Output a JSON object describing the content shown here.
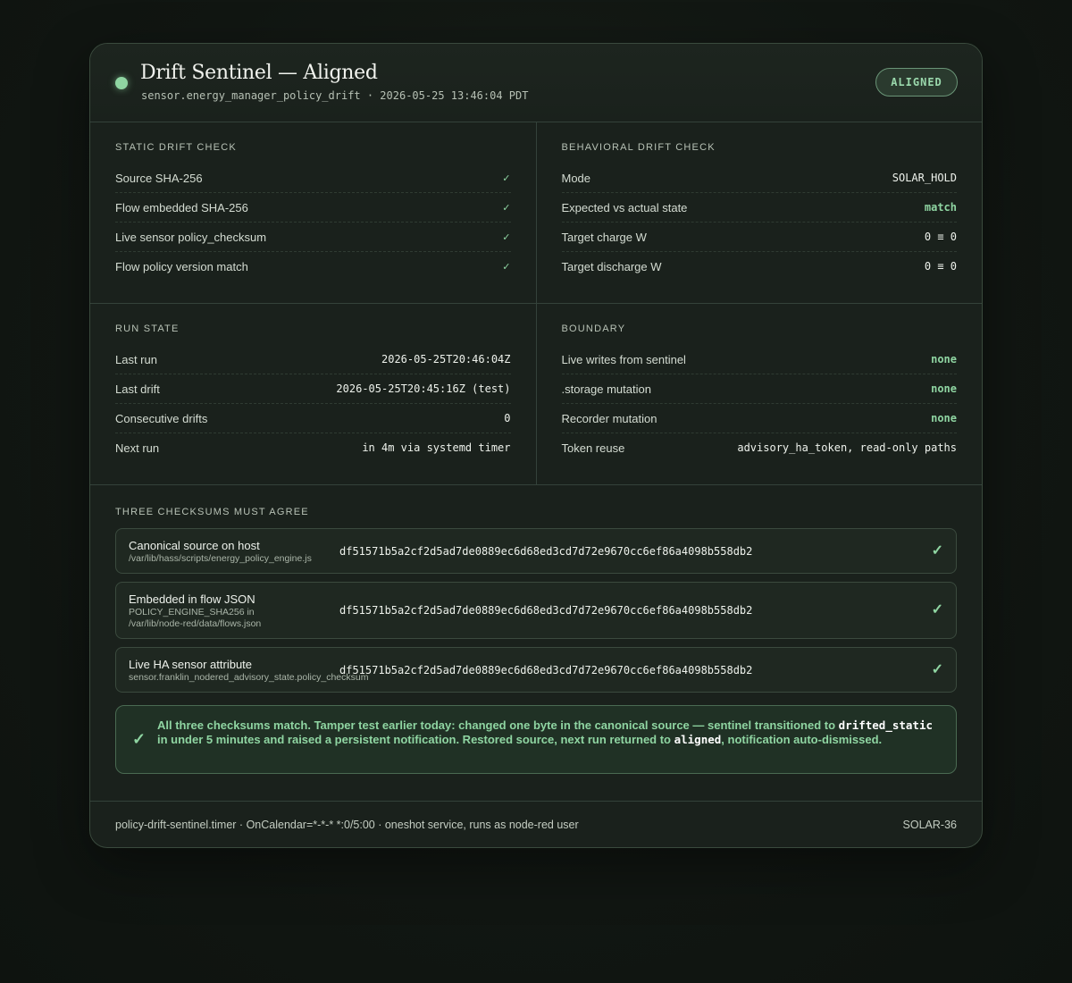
{
  "header": {
    "title": "Drift Sentinel — Aligned",
    "subtitle": "sensor.energy_manager_policy_drift · 2026-05-25 13:46:04 PDT",
    "badge": "ALIGNED",
    "status_color": "#8fd5a2"
  },
  "static_check": {
    "title": "STATIC DRIFT CHECK",
    "rows": [
      {
        "label": "Source SHA-256",
        "value": "✓"
      },
      {
        "label": "Flow embedded SHA-256",
        "value": "✓"
      },
      {
        "label": "Live sensor policy_checksum",
        "value": "✓"
      },
      {
        "label": "Flow policy version match",
        "value": "✓"
      }
    ]
  },
  "behavioral_check": {
    "title": "BEHAVIORAL DRIFT CHECK",
    "rows": [
      {
        "label": "Mode",
        "value": "SOLAR_HOLD"
      },
      {
        "label": "Expected vs actual state",
        "value": "match"
      },
      {
        "label": "Target charge W",
        "value": "0 ≡ 0"
      },
      {
        "label": "Target discharge W",
        "value": "0 ≡ 0"
      }
    ]
  },
  "run_state": {
    "title": "RUN STATE",
    "rows": [
      {
        "label": "Last run",
        "value": "2026-05-25T20:46:04Z"
      },
      {
        "label": "Last drift",
        "value": "2026-05-25T20:45:16Z (test)"
      },
      {
        "label": "Consecutive drifts",
        "value": "0"
      },
      {
        "label": "Next run",
        "value": "in 4m via systemd timer"
      }
    ]
  },
  "boundary": {
    "title": "BOUNDARY",
    "rows": [
      {
        "label": "Live writes from sentinel",
        "value": "none"
      },
      {
        "label": ".storage mutation",
        "value": "none"
      },
      {
        "label": "Recorder mutation",
        "value": "none"
      },
      {
        "label": "Token reuse",
        "value": "advisory_ha_token, read-only paths"
      }
    ]
  },
  "checksums": {
    "title": "THREE CHECKSUMS MUST AGREE",
    "items": [
      {
        "label": "Canonical source on host",
        "path": "/var/lib/hass/scripts/energy_policy_engine.js",
        "hash": "df51571b5a2cf2d5ad7de0889ec6d68ed3cd7d72e9670cc6ef86a4098b558db2",
        "check": "✓"
      },
      {
        "label": "Embedded in flow JSON",
        "path_line1": "POLICY_ENGINE_SHA256 in",
        "path_line2": "/var/lib/node-red/data/flows.json",
        "hash": "df51571b5a2cf2d5ad7de0889ec6d68ed3cd7d72e9670cc6ef86a4098b558db2",
        "check": "✓"
      },
      {
        "label": "Live HA sensor attribute",
        "path": "sensor.franklin_nodered_advisory_state.policy_checksum",
        "hash": "df51571b5a2cf2d5ad7de0889ec6d68ed3cd7d72e9670cc6ef86a4098b558db2",
        "check": "✓"
      }
    ]
  },
  "summary": {
    "icon": "check-icon",
    "text_1": "All three checksums match. Tamper test earlier today: changed one byte in the canonical source — sentinel transitioned to ",
    "code_1": "drifted_static",
    "text_2": " in under 5 minutes and raised a persistent notification. Restored source, next run returned to ",
    "code_2": "aligned",
    "text_3": ", notification auto-dismissed."
  },
  "footer": {
    "left": "policy-drift-sentinel.timer · OnCalendar=*-*-* *:0/5:00 · oneshot service, runs as node-red user",
    "right": "SOLAR-36"
  }
}
